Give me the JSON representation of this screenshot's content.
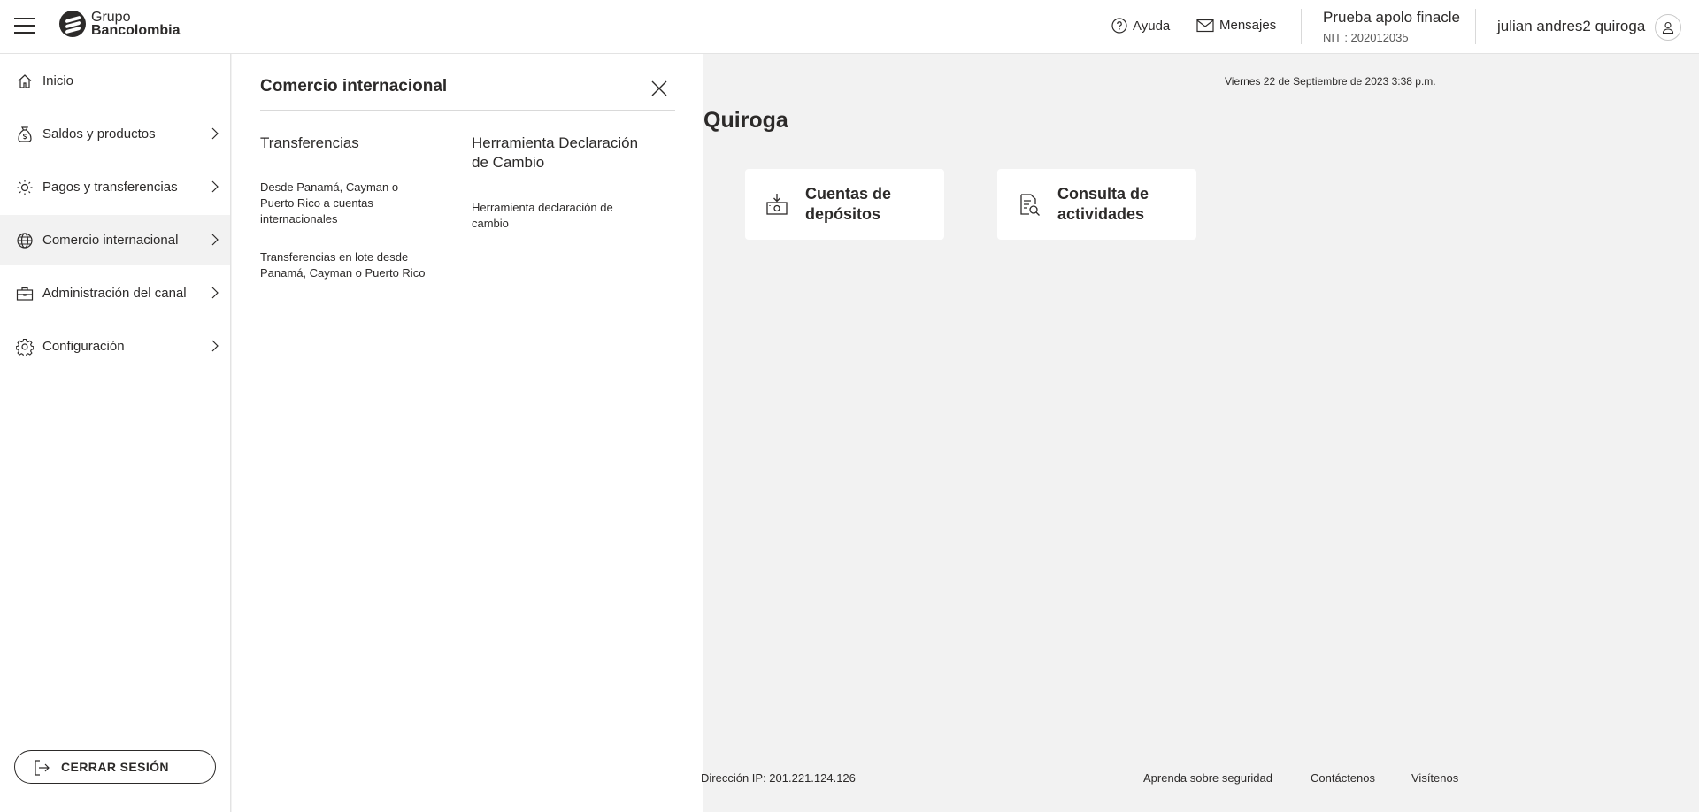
{
  "header": {
    "logo": {
      "line1": "Grupo",
      "line2": "Bancolombia"
    },
    "help_label": "Ayuda",
    "messages_label": "Mensajes",
    "company_name": "Prueba apolo finacle",
    "company_nit": "NIT : 202012035",
    "user_name": "julian andres2 quiroga"
  },
  "sidebar": {
    "items": [
      {
        "label": "Inicio",
        "icon": "home-icon"
      },
      {
        "label": "Saldos y productos",
        "icon": "money-bag-icon"
      },
      {
        "label": "Pagos y transferencias",
        "icon": "transfer-icon"
      },
      {
        "label": "Comercio internacional",
        "icon": "globe-icon"
      },
      {
        "label": "Administración del canal",
        "icon": "briefcase-icon"
      },
      {
        "label": "Configuración",
        "icon": "gear-icon"
      }
    ],
    "logout_label": "CERRAR SESIÓN"
  },
  "panel": {
    "title": "Comercio internacional",
    "col1": {
      "heading": "Transferencias",
      "links": [
        "Desde Panamá, Cayman o Puerto Rico a cuentas internacionales",
        "Transferencias en lote desde Panamá, Cayman o Puerto Rico"
      ]
    },
    "col2": {
      "heading": "Herramienta Declaración de Cambio",
      "links": [
        "Herramienta declaración de cambio"
      ]
    }
  },
  "main": {
    "date": "Viernes 22 de Septiembre de 2023 3:38 p.m.",
    "greeting": "Quiroga",
    "cards": [
      {
        "label": "Cuentas de depósitos",
        "icon": "deposit-icon"
      },
      {
        "label": "Consulta de actividades",
        "icon": "document-search-icon"
      }
    ]
  },
  "footer": {
    "ip": "Dirección IP: 201.221.124.126",
    "links": [
      "Aprenda sobre seguridad",
      "Contáctenos",
      "Visítenos"
    ]
  }
}
